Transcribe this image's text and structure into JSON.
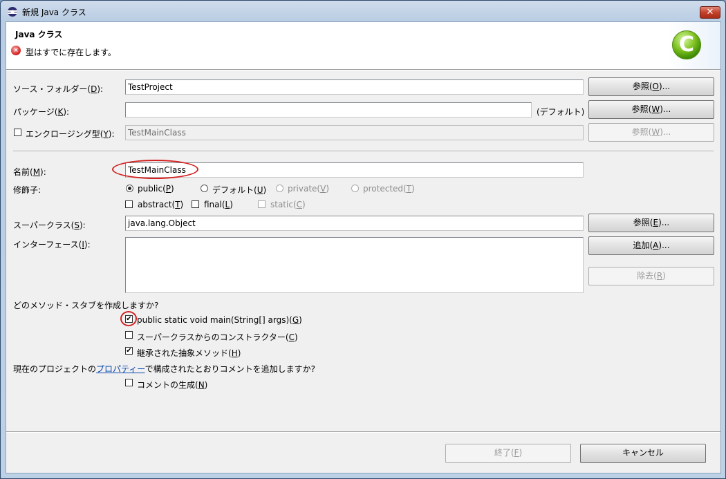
{
  "window": {
    "title": "新規 Java クラス",
    "close_glyph": "✕"
  },
  "banner": {
    "title": "Java クラス",
    "error_message": "型はすでに存在します。",
    "error_glyph": "×",
    "logo_glyph": "C"
  },
  "source_folder": {
    "label": "ソース・フォルダー(",
    "mnemonic": "D",
    "label_end": "):",
    "value": "TestProject",
    "browse_label": "参照(",
    "browse_mnemonic": "O",
    "browse_end": ")..."
  },
  "package": {
    "label": "パッケージ(",
    "mnemonic": "K",
    "label_end": "):",
    "value": "",
    "default_hint": "(デフォルト)",
    "browse_label": "参照(",
    "browse_mnemonic": "W",
    "browse_end": ")..."
  },
  "enclosing_type": {
    "label": "エンクロージング型(",
    "mnemonic": "Y",
    "label_end": "):",
    "value": "TestMainClass",
    "checked": false,
    "browse_label": "参照(",
    "browse_mnemonic": "W",
    "browse_end": ")..."
  },
  "name": {
    "label": "名前(",
    "mnemonic": "M",
    "label_end": "):",
    "value": "TestMainClass"
  },
  "modifiers": {
    "label": "修飾子:",
    "public": {
      "label": "public(",
      "mnemonic": "P",
      "end": ")",
      "checked": true
    },
    "default": {
      "label": "デフォルト(",
      "mnemonic": "U",
      "end": ")",
      "checked": false
    },
    "private": {
      "label": "private(",
      "mnemonic": "V",
      "end": ")",
      "checked": false
    },
    "protected": {
      "label": "protected(",
      "mnemonic": "T",
      "end": ")",
      "checked": false
    },
    "abstract": {
      "label": "abstract(",
      "mnemonic": "T",
      "end": ")",
      "checked": false
    },
    "final": {
      "label": "final(",
      "mnemonic": "L",
      "end": ")",
      "checked": false
    },
    "static": {
      "label": "static(",
      "mnemonic": "C",
      "end": ")",
      "checked": false
    }
  },
  "superclass": {
    "label": "スーパークラス(",
    "mnemonic": "S",
    "label_end": "):",
    "value": "java.lang.Object",
    "browse_label": "参照(",
    "browse_mnemonic": "E",
    "browse_end": ")..."
  },
  "interfaces": {
    "label": "インターフェース(",
    "mnemonic": "I",
    "label_end": "):",
    "add_label": "追加(",
    "add_mnemonic": "A",
    "add_end": ")...",
    "remove_label": "除去(",
    "remove_mnemonic": "R",
    "remove_end": ")"
  },
  "stubs": {
    "question": "どのメソッド・スタブを作成しますか?",
    "main": {
      "label": "public static void main(String[] args)(",
      "mnemonic": "G",
      "end": ")",
      "checked": true
    },
    "constructors": {
      "label": "スーパークラスからのコンストラクター(",
      "mnemonic": "C",
      "end": ")",
      "checked": false
    },
    "inherited": {
      "label": "継承された抽象メソッド(",
      "mnemonic": "H",
      "end": ")",
      "checked": true
    }
  },
  "comments": {
    "question_pre": "現在のプロジェクトの",
    "question_link": "プロパティー",
    "question_post": "で構成されたとおりコメントを追加しますか?",
    "generate": {
      "label": "コメントの生成(",
      "mnemonic": "N",
      "end": ")",
      "checked": false
    }
  },
  "footer": {
    "finish_label": "終了(",
    "finish_mnemonic": "F",
    "finish_end": ")",
    "cancel_label": "キャンセル"
  },
  "check_glyph": "✔"
}
